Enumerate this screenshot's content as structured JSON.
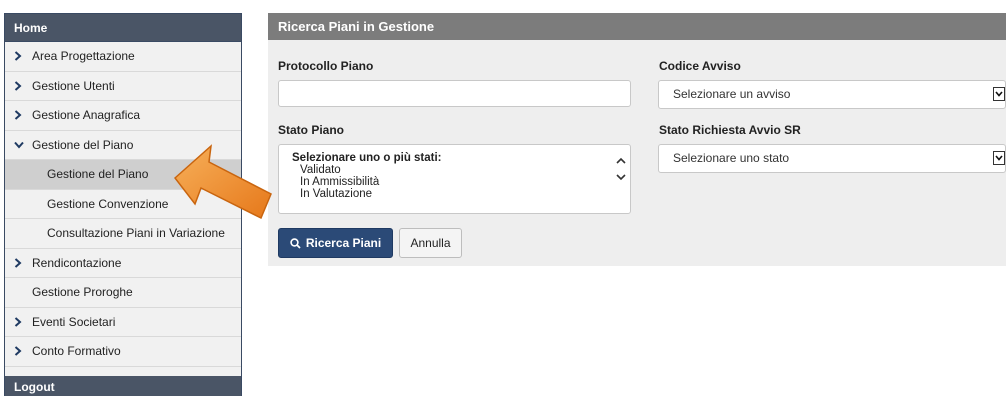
{
  "sidebar": {
    "home": "Home",
    "items": [
      {
        "label": "Area Progettazione"
      },
      {
        "label": "Gestione Utenti"
      },
      {
        "label": "Gestione Anagrafica"
      },
      {
        "label": "Gestione del Piano"
      },
      {
        "label": "Gestione del Piano"
      },
      {
        "label": "Gestione Convenzione"
      },
      {
        "label": "Consultazione Piani in Variazione"
      },
      {
        "label": "Rendicontazione"
      },
      {
        "label": "Gestione Proroghe"
      },
      {
        "label": "Eventi Societari"
      },
      {
        "label": "Conto Formativo"
      }
    ],
    "logout": "Logout"
  },
  "panel": {
    "title": "Ricerca Piani in Gestione",
    "protocollo_label": "Protocollo Piano",
    "protocollo_value": "",
    "codice_label": "Codice Avviso",
    "codice_value": "Selezionare un avviso",
    "stato_label": "Stato Piano",
    "stato_header": "Selezionare uno o più stati:",
    "stato_options": [
      "Validato",
      "In Ammissibilità",
      "In Valutazione"
    ],
    "stato_sr_label": "Stato Richiesta Avvio SR",
    "stato_sr_value": "Selezionare uno stato",
    "search_button": "Ricerca Piani",
    "cancel_button": "Annulla"
  },
  "colors": {
    "sidebar_header": "#4a5566",
    "panel_header": "#7c7c7c",
    "primary_button": "#2b4a77",
    "arrow": "#f08a24"
  }
}
